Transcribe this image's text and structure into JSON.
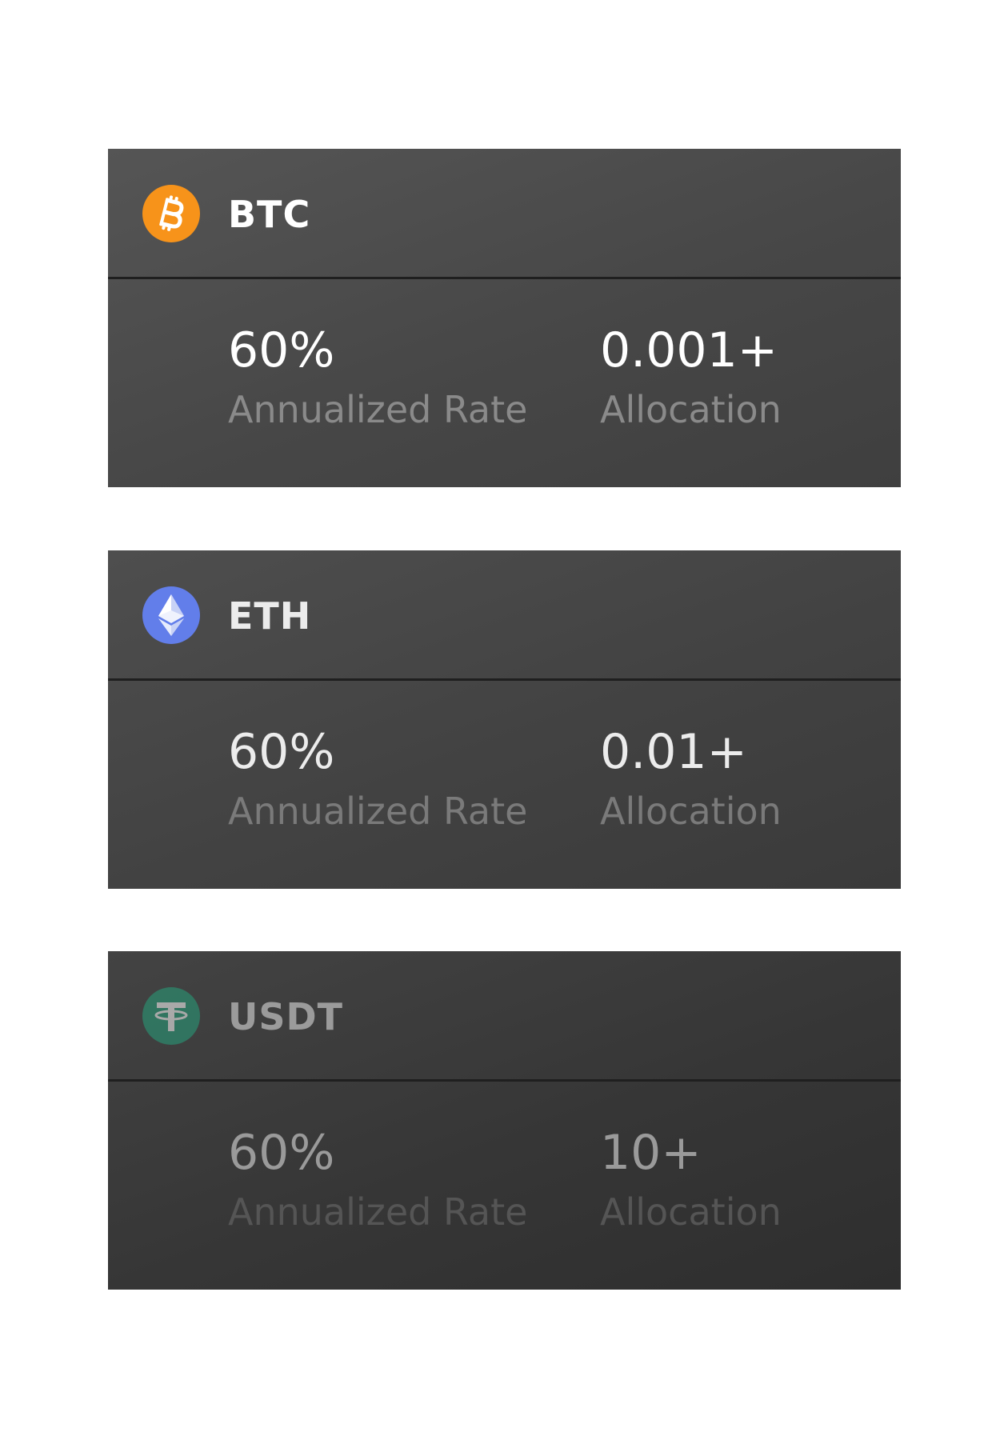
{
  "cards": [
    {
      "symbol": "BTC",
      "icon": "bitcoin-icon",
      "icon_color": "#F7931A",
      "rate_value": "60%",
      "rate_label": "Annualized Rate",
      "allocation_value": "0.001+",
      "allocation_label": "Allocation"
    },
    {
      "symbol": "ETH",
      "icon": "ethereum-icon",
      "icon_color": "#627EEA",
      "rate_value": "60%",
      "rate_label": "Annualized Rate",
      "allocation_value": "0.01+",
      "allocation_label": "Allocation"
    },
    {
      "symbol": "USDT",
      "icon": "tether-icon",
      "icon_color": "#26A17B",
      "rate_value": "60%",
      "rate_label": "Annualized Rate",
      "allocation_value": "10+",
      "allocation_label": "Allocation"
    }
  ]
}
